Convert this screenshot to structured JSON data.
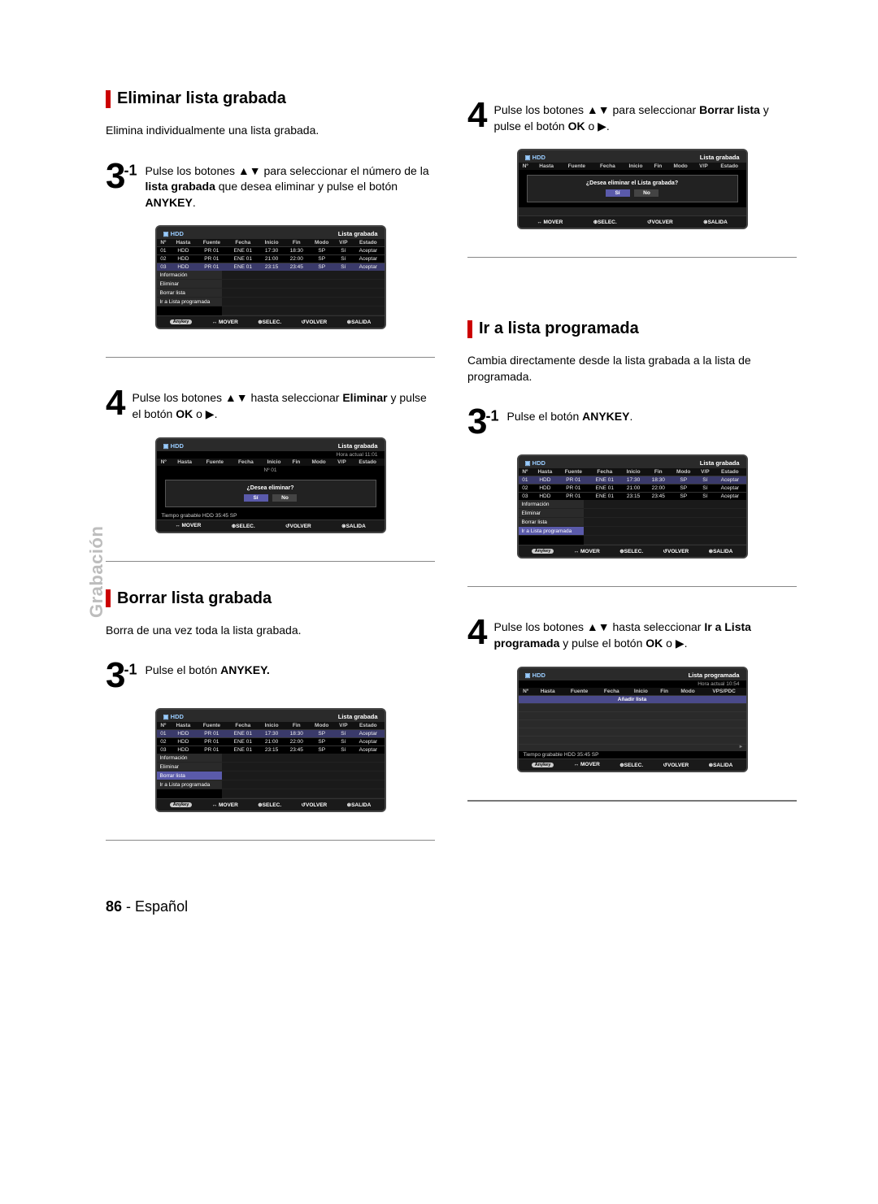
{
  "sideTab": "Grabación",
  "pageNumber": "86",
  "pageLang": "Español",
  "left": {
    "sectionA": {
      "title": "Eliminar lista grabada",
      "intro": "Elimina individualmente una lista grabada.",
      "step3": {
        "num": "3",
        "sup": "-1",
        "pre": "Pulse los botones ",
        "mid": " para seleccionar el número de la ",
        "b1": "lista grabada",
        "post": " que desea eliminar y pulse el botón ",
        "b2": "ANYKEY",
        "end": "."
      },
      "step4": {
        "num": "4",
        "pre": "Pulse los botones ",
        "mid": " hasta seleccionar ",
        "b1": "Eliminar",
        "post": " y pulse el botón ",
        "b2": "OK",
        "o": " o ",
        "end": "."
      }
    },
    "sectionB": {
      "title": "Borrar lista grabada",
      "intro": "Borra de una vez toda la lista grabada.",
      "step3": {
        "num": "3",
        "sup": "-1",
        "pre": "Pulse el botón ",
        "b1": "ANYKEY.",
        "end": ""
      }
    }
  },
  "right": {
    "step4Top": {
      "num": "4",
      "pre": "Pulse los botones ",
      "mid": " para seleccionar ",
      "b1": "Borrar lista",
      "post": " y pulse el botón ",
      "b2": "OK",
      "o": " o ",
      "end": "."
    },
    "sectionC": {
      "title": "Ir a lista programada",
      "intro": "Cambia directamente desde la lista grabada a la lista de programada.",
      "step3": {
        "num": "3",
        "sup": "-1",
        "pre": "Pulse el botón ",
        "b1": "ANYKEY",
        "end": "."
      },
      "step4": {
        "num": "4",
        "pre": "Pulse los botones ",
        "mid": " hasta seleccionar ",
        "b1": "Ir a Lista programada",
        "post": " y pulse el botón ",
        "b2": "OK",
        "o": " o ",
        "end": "."
      }
    }
  },
  "mock": {
    "hdd": "HDD",
    "titleRecorded": "Lista grabada",
    "titleScheduled": "Lista programada",
    "timeNow1": "Hora actual 11:01",
    "timeNow2": "Hora actual 10:54",
    "timeRec": "Tiempo grabable    HDD  35:45 SP",
    "headers": [
      "Nº",
      "Hasta",
      "Fuente",
      "Fecha",
      "Inicio",
      "Fin",
      "Modo",
      "V/P",
      "Estado"
    ],
    "headersSched": [
      "Nº",
      "Hasta",
      "Fuente",
      "Fecha",
      "Inicio",
      "Fin",
      "Modo",
      "VPS/PDC"
    ],
    "rows": [
      [
        "01",
        "HDD",
        "PR 01",
        "ENE 01",
        "17:30",
        "18:30",
        "SP",
        "Sí",
        "Aceptar"
      ],
      [
        "02",
        "HDD",
        "PR 01",
        "ENE 01",
        "21:00",
        "22:00",
        "SP",
        "Sí",
        "Aceptar"
      ],
      [
        "03",
        "HDD",
        "PR 01",
        "ENE 01",
        "23:15",
        "23:45",
        "SP",
        "Sí",
        "Aceptar"
      ]
    ],
    "menu": [
      "Información",
      "Eliminar",
      "Borrar lista",
      "Ir a Lista programada"
    ],
    "footer": {
      "anykey": "Anykey",
      "mover": "MOVER",
      "selec": "SELEC.",
      "volver": "VOLVER",
      "salida": "SALIDA"
    },
    "dialogDeleteList": "¿Desea eliminar el Lista grabada?",
    "dialogDelete": "¿Desea eliminar?",
    "dialogNo": "Nº 01",
    "yes": "Sí",
    "no": "No",
    "addList": "Añadir lista"
  }
}
